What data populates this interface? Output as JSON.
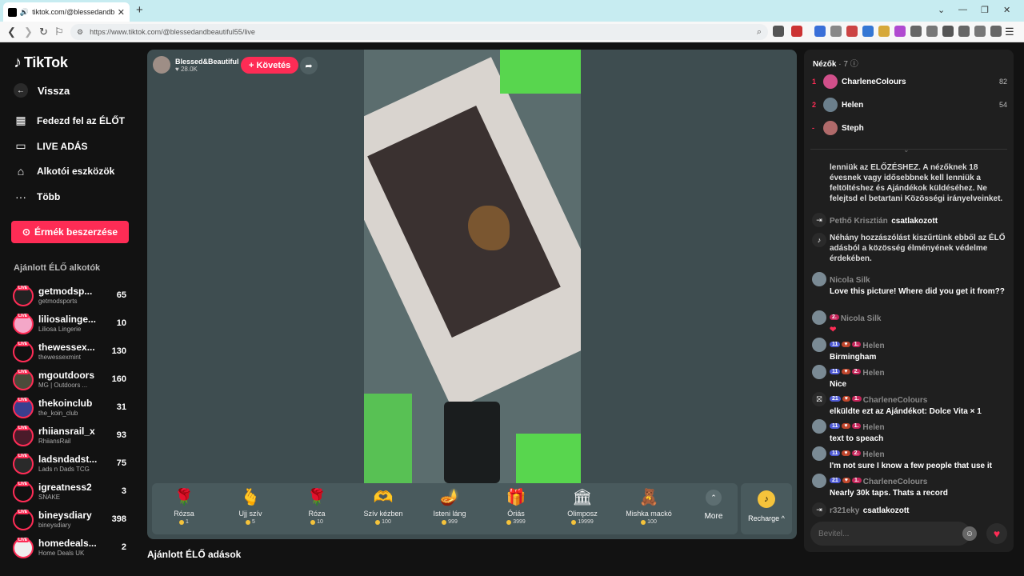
{
  "browser": {
    "tab_title": "tiktok.com/@blessedandbea",
    "url": "https://www.tiktok.com/@blessedandbeautiful55/live"
  },
  "sidebar": {
    "brand": "TikTok",
    "back": "Vissza",
    "nav": [
      {
        "label": "Fedezd fel az ÉLŐT",
        "icon": "calendar-icon"
      },
      {
        "label": "LIVE ADÁS",
        "icon": "video-camera-icon"
      },
      {
        "label": "Alkotói eszközök",
        "icon": "home-tools-icon"
      },
      {
        "label": "Több",
        "icon": "more-dots-icon"
      }
    ],
    "coin_button": "Érmék beszerzése",
    "recommended_title": "Ajánlott ÉLŐ alkotók",
    "creators": [
      {
        "name": "getmodsp...",
        "sub": "getmodsports",
        "count": "65",
        "color": "#222"
      },
      {
        "name": "liliosalinge...",
        "sub": "Liliosa Lingerie",
        "count": "10",
        "color": "#f4a7c8"
      },
      {
        "name": "thewessex...",
        "sub": "thewessexmint",
        "count": "130",
        "color": "#111"
      },
      {
        "name": "mgoutdoors",
        "sub": "MG | Outdoors ...",
        "count": "160",
        "color": "#4b4b3a"
      },
      {
        "name": "thekoinclub",
        "sub": "the_koin_club",
        "count": "31",
        "color": "#3a3f8f"
      },
      {
        "name": "rhiiansrail_x",
        "sub": "RhiiansRail",
        "count": "93",
        "color": "#4a1b2a"
      },
      {
        "name": "ladsndadst...",
        "sub": "Lads n Dads TCG",
        "count": "75",
        "color": "#2a2a2a"
      },
      {
        "name": "igreatness2",
        "sub": "SNAKE",
        "count": "3",
        "color": "#111"
      },
      {
        "name": "bineysdiary",
        "sub": "bineysdiary",
        "count": "398",
        "color": "#111"
      },
      {
        "name": "homedeals...",
        "sub": "Home Deals UK",
        "count": "2",
        "color": "#eee"
      }
    ]
  },
  "stream": {
    "host_name": "Blessed&Beautiful",
    "likes": "28.0K",
    "follow": "+ Követés"
  },
  "gifts": [
    {
      "name": "Rózsa",
      "price": "1",
      "glyph": "🌹"
    },
    {
      "name": "Ujj szív",
      "price": "5",
      "glyph": "🫰"
    },
    {
      "name": "Róza",
      "price": "10",
      "glyph": "🌹"
    },
    {
      "name": "Szív kézben",
      "price": "100",
      "glyph": "🫶"
    },
    {
      "name": "Isteni láng",
      "price": "999",
      "glyph": "🪔"
    },
    {
      "name": "Óriás",
      "price": "3999",
      "glyph": "🎁"
    },
    {
      "name": "Olimposz",
      "price": "19999",
      "glyph": "🏛"
    },
    {
      "name": "Mishka mackó",
      "price": "100",
      "glyph": "🧸"
    }
  ],
  "more_label": "More",
  "recharge_label": "Recharge ^",
  "suggest_heading": "Ajánlott ÉLŐ adások",
  "viewers": {
    "title": "Nézők",
    "count": "· 7",
    "list": [
      {
        "rank": "1",
        "name": "CharleneColours",
        "score": "82",
        "color": "#d14f8a"
      },
      {
        "rank": "2",
        "name": "Helen",
        "score": "54",
        "color": "#6b7f8c"
      },
      {
        "rank": "-",
        "name": "Steph",
        "score": "",
        "color": "#b06a6a"
      }
    ]
  },
  "chat": [
    {
      "kind": "notice",
      "text": "lenniük az ELŐZÉSHEZ. A nézőknek 18 évesnek vagy idősebbnek kell lenniük a feltöltéshez és Ajándékok küldéséhez. Ne felejtsd el betartani Közösségi irányelveinket."
    },
    {
      "kind": "join",
      "name": "Pethő Krisztián",
      "text": "csatlakozott"
    },
    {
      "kind": "notice",
      "text": "Néhány hozzászólást kiszűrtünk ebből az ÉLŐ adásból a közösség élményének védelme érdekében."
    },
    {
      "kind": "msg",
      "name": "Nicola Silk",
      "badges": [],
      "text": "Love this picture! Where did you get it from??"
    },
    {
      "kind": "msg",
      "name": "Nicola Silk",
      "badges": [
        "2."
      ],
      "text": "❤"
    },
    {
      "kind": "msg",
      "name": "Helen",
      "level": "11",
      "badges": [
        "1."
      ],
      "text": "Birmingham"
    },
    {
      "kind": "msg",
      "name": "Helen",
      "level": "11",
      "badges": [
        "2."
      ],
      "text": "Nice"
    },
    {
      "kind": "msg",
      "name": "CharleneColours",
      "level": "21",
      "badges": [
        "1."
      ],
      "text": "elküldte ezt az Ajándékot: Dolce Vita × 1"
    },
    {
      "kind": "msg",
      "name": "Helen",
      "level": "11",
      "badges": [
        "1."
      ],
      "text": "text to speach"
    },
    {
      "kind": "msg",
      "name": "Helen",
      "level": "11",
      "badges": [
        "2."
      ],
      "text": "I'm not sure I know a few people that use it"
    },
    {
      "kind": "msg",
      "name": "CharleneColours",
      "level": "21",
      "badges": [
        "1."
      ],
      "text": "Nearly 30k taps. Thats a record"
    },
    {
      "kind": "join",
      "name": "r321eky",
      "text": "csatlakozott"
    }
  ],
  "input_placeholder": "Bevitel..."
}
